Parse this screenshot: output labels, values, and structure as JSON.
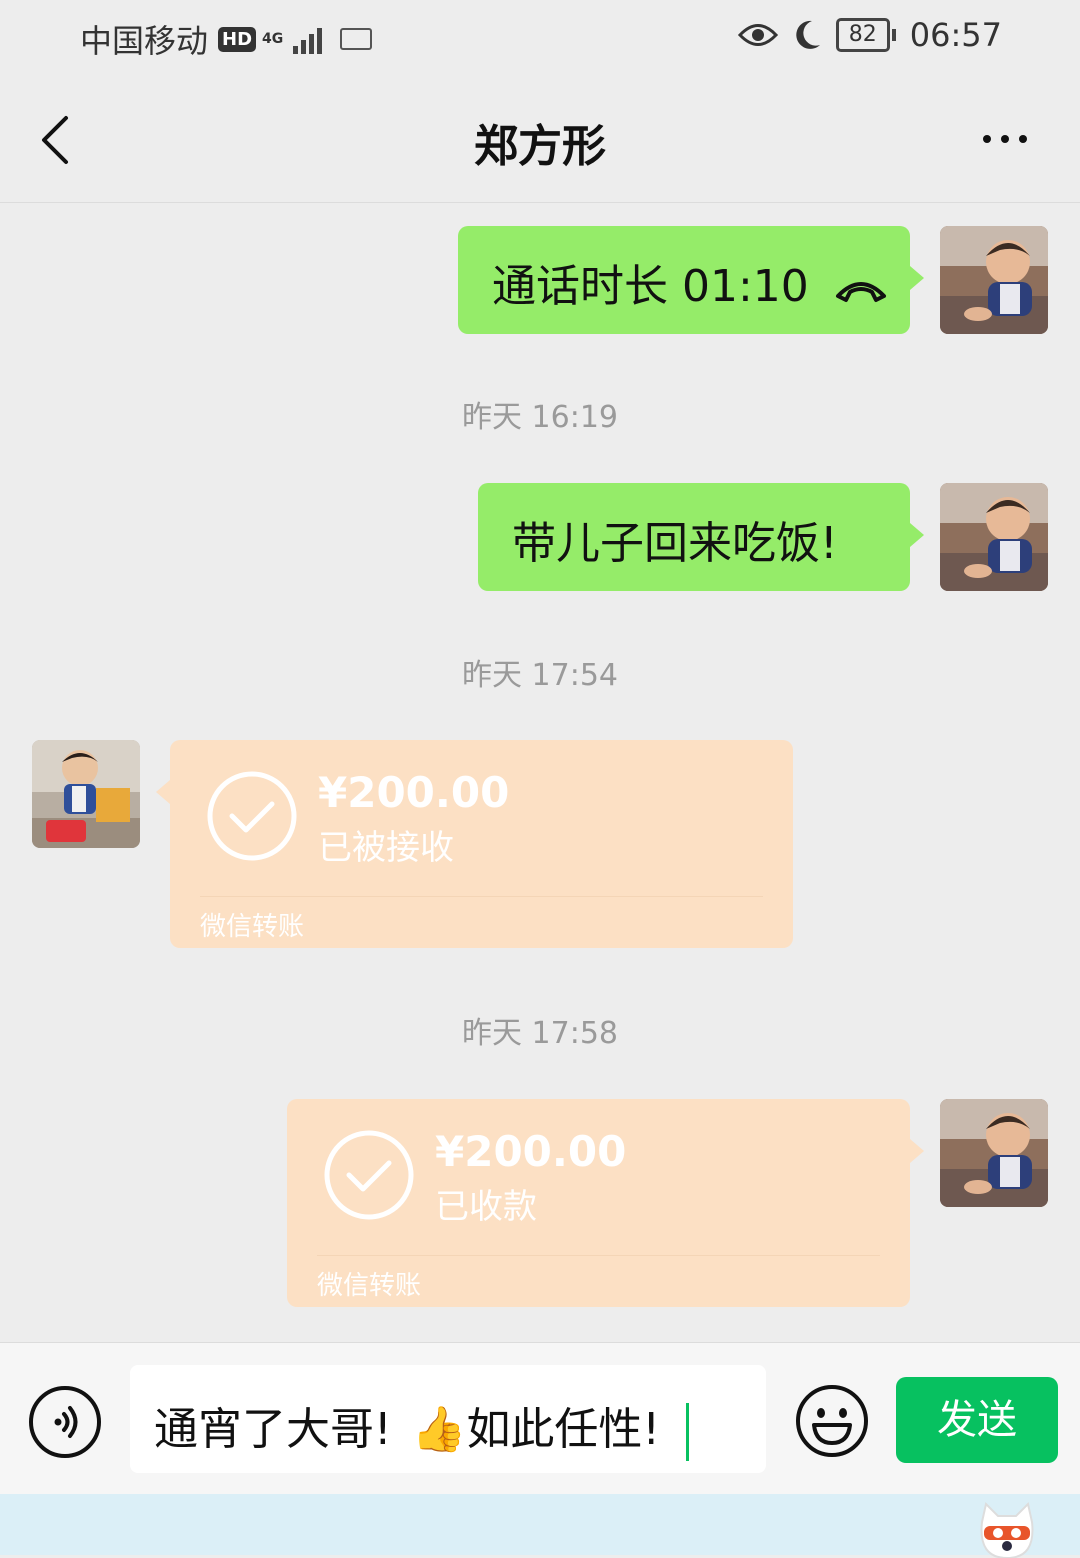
{
  "status_bar": {
    "carrier": "中国移动",
    "hd": "HD",
    "network": "4G",
    "battery": "82",
    "time": "06:57"
  },
  "header": {
    "title": "郑方形"
  },
  "messages": {
    "call": {
      "text": "通话时长 01:10"
    },
    "ts1": "昨天 16:19",
    "msg1": {
      "text": "带儿子回来吃饭!"
    },
    "ts2": "昨天 17:54",
    "transfer1": {
      "amount": "¥200.00",
      "status": "已被接收",
      "footer": "微信转账"
    },
    "ts3": "昨天 17:58",
    "transfer2": {
      "amount": "¥200.00",
      "status": "已收款",
      "footer": "微信转账"
    }
  },
  "input": {
    "text_before": "通宵了大哥!",
    "emoji": "👍",
    "text_after": "如此任性!",
    "send_label": "发送"
  },
  "colors": {
    "accent": "#07c160",
    "bubble_green": "#95ec69",
    "transfer": "#fce0c4",
    "background": "#ededed"
  }
}
